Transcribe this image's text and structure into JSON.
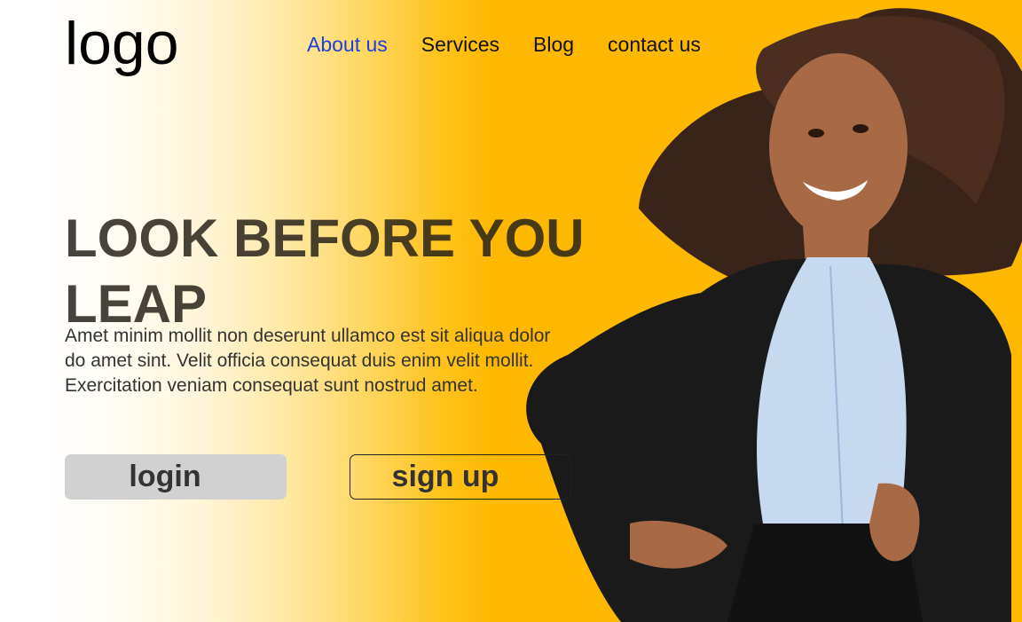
{
  "header": {
    "logo_text": "logo",
    "nav": [
      {
        "label": "About us",
        "active": true
      },
      {
        "label": "Services",
        "active": false
      },
      {
        "label": "Blog",
        "active": false
      },
      {
        "label": "contact us",
        "active": false
      }
    ]
  },
  "hero": {
    "headline": "LOOK BEFORE YOU LEAP",
    "body": "Amet minim mollit non deserunt ullamco est sit aliqua dolor do amet sint. Velit officia consequat duis enim velit mollit. Exercitation veniam consequat sunt nostrud amet.",
    "login_label": "login",
    "signup_label": "sign up"
  },
  "colors": {
    "accent": "#ffb800",
    "active_link": "#1a3fe0",
    "login_button": "#d1d1d1"
  }
}
